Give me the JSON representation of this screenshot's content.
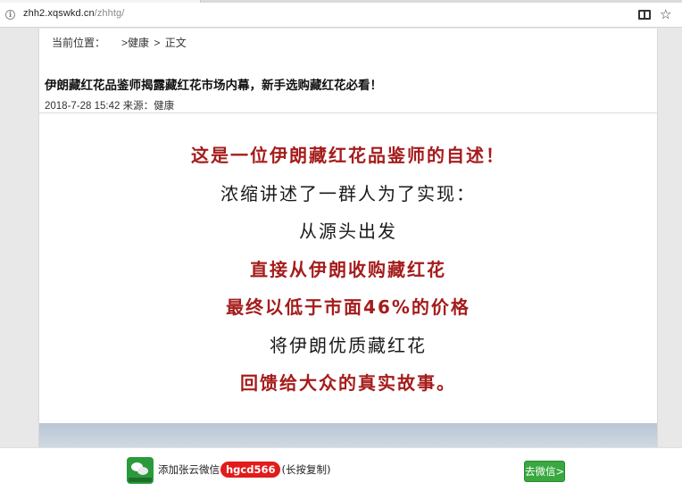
{
  "browser": {
    "url_host": "zhh2.xqswkd.cn",
    "url_path": "/zhhtg/",
    "info_icon_glyph": "i",
    "reader_icon": "reader-view-icon",
    "star_icon": "bookmark-star-icon",
    "star_glyph": "☆"
  },
  "breadcrumb": {
    "label": "当前位置：",
    "category": ">健康",
    "separator": ">",
    "current": "正文"
  },
  "article": {
    "title": "伊朗藏红花品鉴师揭露藏红花市场内幕，新手选购藏红花必看！",
    "date": "2018-7-28 15:42",
    "source_label": "来源：",
    "source": "健康"
  },
  "story_lines": [
    {
      "text": "这是一位伊朗藏红花品鉴师的自述！",
      "emphasis": true
    },
    {
      "text": "浓缩讲述了一群人为了实现：",
      "emphasis": false
    },
    {
      "text": "从源头出发",
      "emphasis": false
    },
    {
      "text": "直接从伊朗收购藏红花",
      "emphasis": true
    },
    {
      "text": "最终以低于市面46%的价格",
      "emphasis": true
    },
    {
      "text": "将伊朗优质藏红花",
      "emphasis": false
    },
    {
      "text": "回馈给大众的真实故事。",
      "emphasis": true
    }
  ],
  "promo_bar": {
    "logo_icon": "wechat-logo-icon",
    "prefix": "添加张云微信",
    "wechat_id": "hgcd566",
    "suffix": "(长按复制)",
    "button_label": "去微信>"
  },
  "colors": {
    "emphasis_red": "#a51c1c",
    "id_badge_red": "#e21b1b",
    "button_green": "#38a83f"
  }
}
